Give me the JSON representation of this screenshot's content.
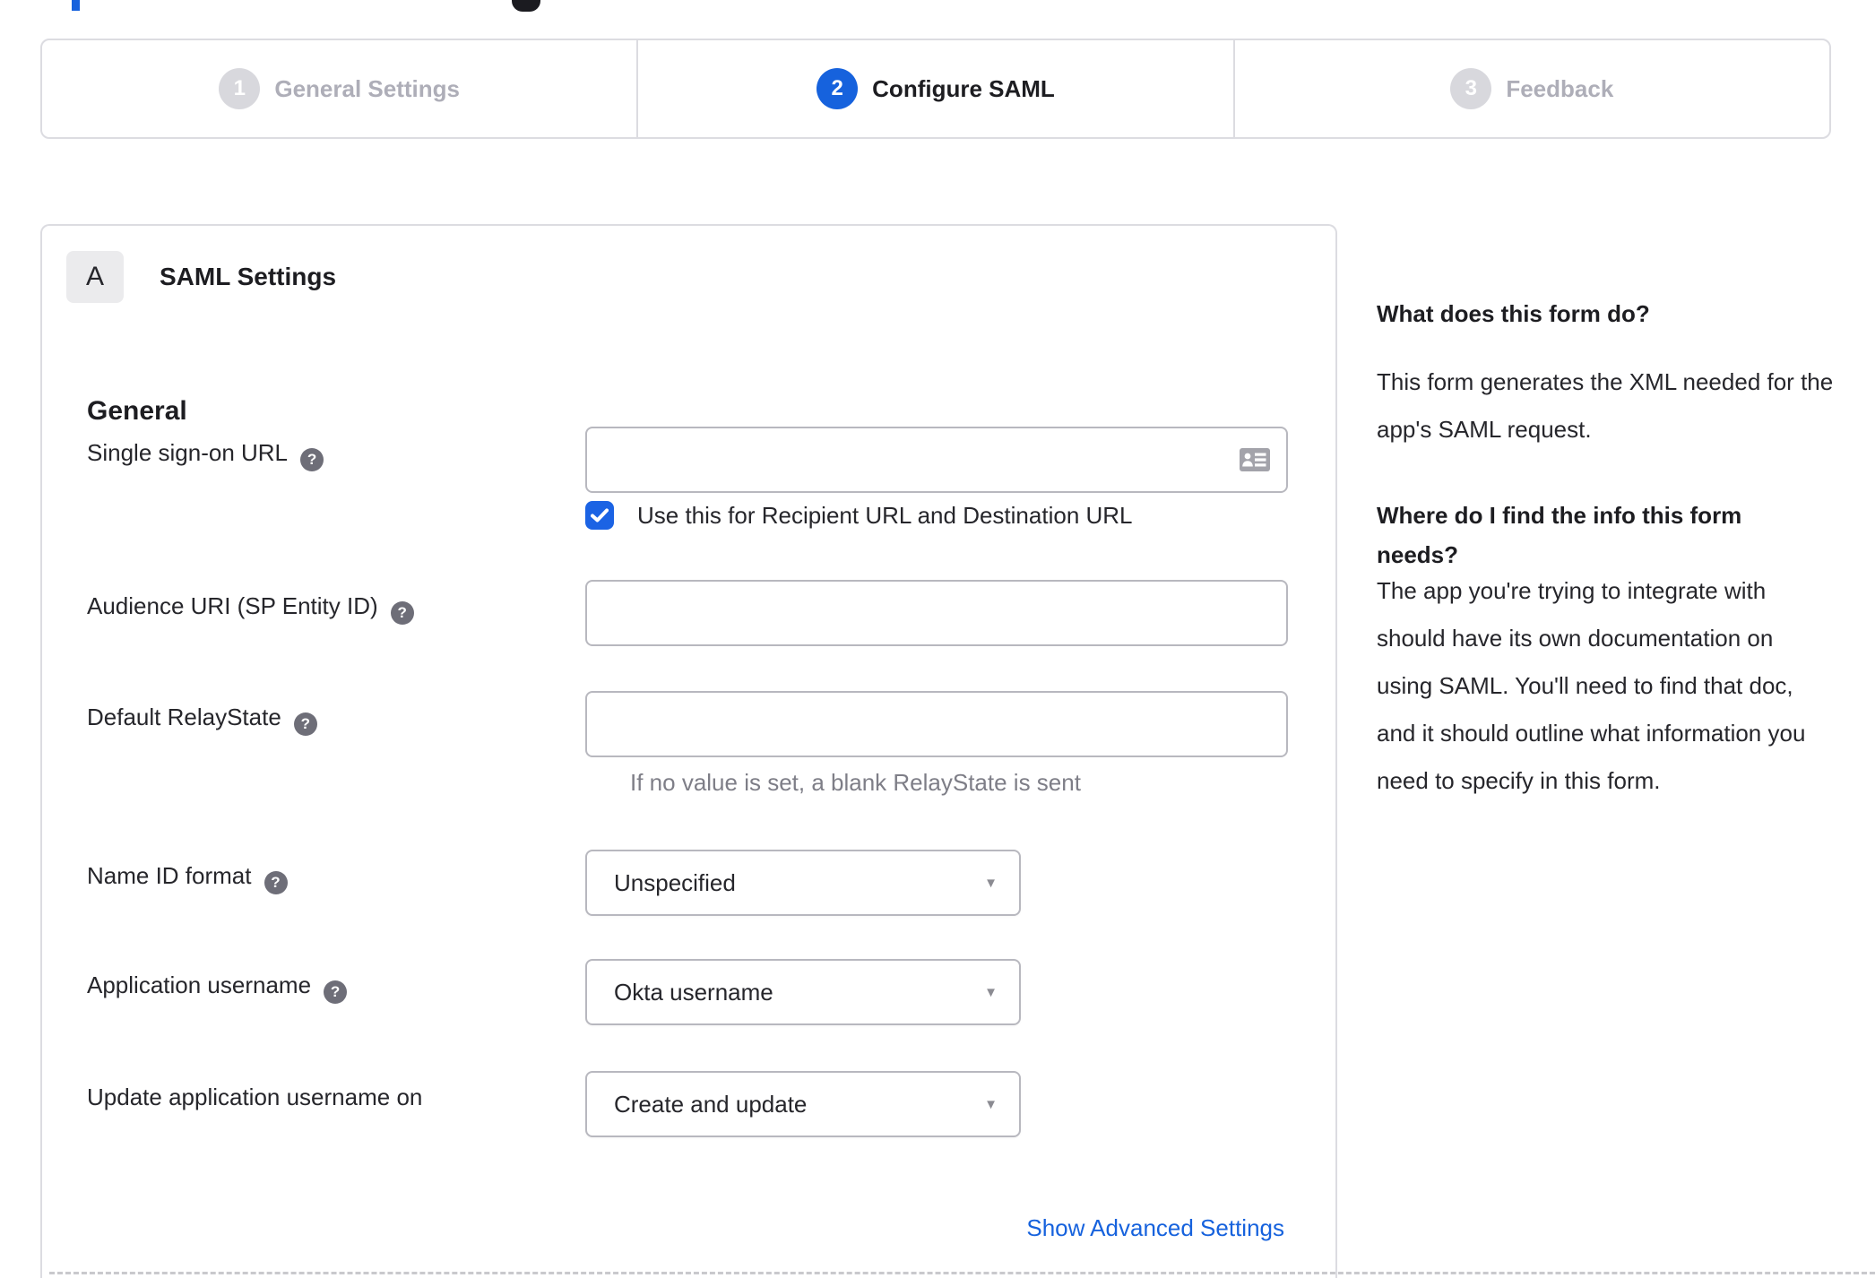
{
  "stepper": {
    "steps": [
      {
        "number": "1",
        "label": "General Settings",
        "active": false
      },
      {
        "number": "2",
        "label": "Configure SAML",
        "active": true
      },
      {
        "number": "3",
        "label": "Feedback",
        "active": false
      }
    ]
  },
  "form": {
    "badge": "A",
    "title": "SAML Settings",
    "section": "General",
    "fields": {
      "sso": {
        "label": "Single sign-on URL",
        "value": "",
        "checkbox_label": "Use this for Recipient URL and Destination URL",
        "checkbox_checked": true
      },
      "audience": {
        "label": "Audience URI (SP Entity ID)",
        "value": ""
      },
      "relay": {
        "label": "Default RelayState",
        "value": "",
        "hint": "If no value is set, a blank RelayState is sent"
      },
      "name_id": {
        "label": "Name ID format",
        "value": "Unspecified"
      },
      "app_username": {
        "label": "Application username",
        "value": "Okta username"
      },
      "update_username": {
        "label": "Update application username on",
        "value": "Create and update"
      }
    },
    "advanced_link": "Show Advanced Settings"
  },
  "sidebar": {
    "sections": [
      {
        "heading": "What does this form do?",
        "body": "This form generates the XML needed for the app's SAML request."
      },
      {
        "heading": "Where do I find the info this form needs?",
        "body": "The app you're trying to integrate with should have its own documentation on using SAML. You'll need to find that doc, and it should outline what information you need to specify in this form."
      }
    ]
  },
  "icons": {
    "help": "?",
    "dropdown": "▼"
  },
  "colors": {
    "accent_blue": "#1662dd",
    "checkbox_blue": "#1b63e4",
    "link_blue": "#1662dd"
  }
}
